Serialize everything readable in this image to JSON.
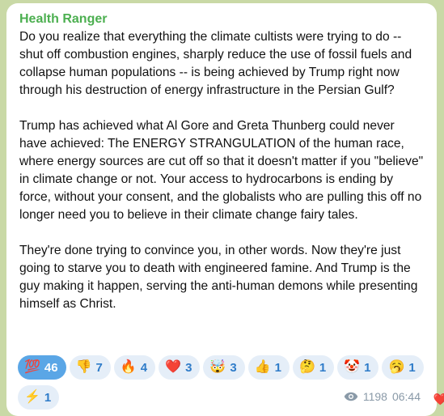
{
  "message": {
    "sender": "Health Ranger",
    "paragraphs": [
      "Do you realize that everything the climate cultists were trying to do -- shut off combustion engines, sharply reduce the use of fossil fuels and collapse human populations -- is being achieved by Trump right now through his destruction of energy infrastructure in the Persian Gulf?",
      "Trump has achieved what Al Gore and Greta Thunberg could never have achieved: The ENERGY STRANGULATION of the human race, where energy sources are cut off so that it doesn't matter if you \"believe\" in climate change or not. Your access to hydrocarbons is ending by force, without your consent, and the globalists who are pulling this off no longer need you to believe in their climate change fairy tales.",
      "They're done trying to convince you, in other words. Now they're just going to starve you to death with engineered famine. And Trump is the guy making it happen, serving the anti-human demons while presenting himself as Christ."
    ],
    "reactions": [
      {
        "emoji": "💯",
        "count": "46",
        "active": true
      },
      {
        "emoji": "👎",
        "count": "7"
      },
      {
        "emoji": "🔥",
        "count": "4"
      },
      {
        "emoji": "❤️",
        "count": "3"
      },
      {
        "emoji": "🤯",
        "count": "3"
      },
      {
        "emoji": "👍",
        "count": "1"
      },
      {
        "emoji": "🤔",
        "count": "1"
      },
      {
        "emoji": "🤡",
        "count": "1"
      },
      {
        "emoji": "🥱",
        "count": "1"
      },
      {
        "emoji": "⚡",
        "count": "1"
      }
    ],
    "views": "1198",
    "time": "06:44",
    "views_icon": "eye-icon",
    "sender_color": "#4caf50",
    "active_reaction_color": "#5aa6e6"
  }
}
